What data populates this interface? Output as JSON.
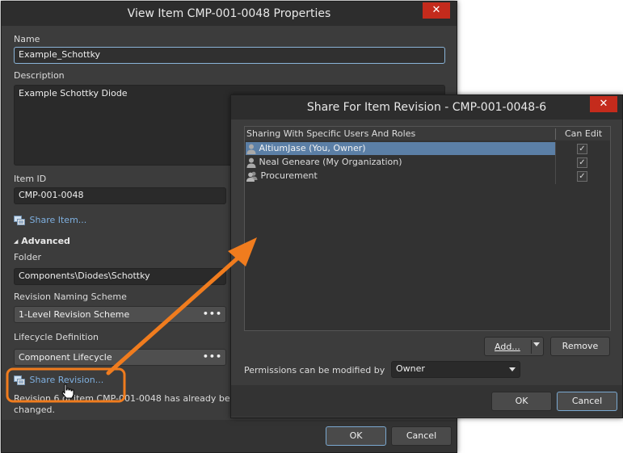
{
  "main_dialog": {
    "title": "View Item CMP-001-0048 Properties",
    "close_glyph": "✕",
    "name_label": "Name",
    "name_value": "Example_Schottky",
    "description_label": "Description",
    "description_value": "Example Schottky Diode",
    "item_id_label": "Item ID",
    "item_id_value": "CMP-001-0048",
    "share_item_link": "Share Item...",
    "advanced_label": "Advanced",
    "folder_label": "Folder",
    "folder_value": "Components\\Diodes\\Schottky",
    "revision_scheme_label": "Revision Naming Scheme",
    "revision_scheme_value": "1-Level Revision Scheme",
    "lifecycle_label": "Lifecycle Definition",
    "lifecycle_value": "Component Lifecycle",
    "ellipsis": "•••",
    "share_revision_link": "Share Revision...",
    "revision_note_line1": "Revision 6 of item CMP-001-0048 has already been re",
    "revision_note_line2": "changed.",
    "ok_label": "OK",
    "cancel_label": "Cancel"
  },
  "share_dialog": {
    "title": "Share For Item Revision - CMP-001-0048-6",
    "close_glyph": "✕",
    "column_sharing": "Sharing With Specific Users And Roles",
    "column_can_edit": "Can Edit",
    "rows": [
      {
        "name": "AltiumJase (You, Owner)",
        "icon": "user-icon",
        "can_edit": true,
        "selected": true
      },
      {
        "name": "Neal Geneare (My Organization)",
        "icon": "user-icon",
        "can_edit": true,
        "selected": false
      },
      {
        "name": "Procurement",
        "icon": "group-icon",
        "can_edit": true,
        "selected": false
      }
    ],
    "check_glyph": "✓",
    "add_label": "Add...",
    "remove_label": "Remove",
    "permissions_label": "Permissions can be modified by",
    "permissions_value": "Owner",
    "ok_label": "OK",
    "cancel_label": "Cancel"
  },
  "colors": {
    "dialog_bg": "#3c3c3c",
    "titlebar_bg": "#2d2d2d",
    "close_red": "#c42b1c",
    "link_blue": "#7fb0e0",
    "selection_blue": "#5b7fa6",
    "callout_orange": "#f07c1e"
  }
}
